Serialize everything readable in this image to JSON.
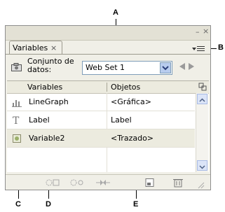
{
  "callouts": {
    "a": "A",
    "b": "B",
    "c": "C",
    "d": "D",
    "e": "E"
  },
  "panel": {
    "tab_label": "Variables",
    "tab_close": "×",
    "minimize": "–",
    "close": "×"
  },
  "dataset": {
    "label": "Conjunto de datos:",
    "selected": "Web Set 1"
  },
  "table": {
    "columns": [
      "Variables",
      "Objetos"
    ],
    "rows": [
      {
        "icon": "line-graph-icon",
        "name": "LineGraph",
        "object": "<Gráfica>"
      },
      {
        "icon": "text-variable-icon",
        "name": "Label",
        "object": "Label"
      },
      {
        "icon": "visibility-variable-icon",
        "name": "Variable2",
        "object": "<Trazado>"
      }
    ]
  },
  "colors": {
    "panel_bg": "#f0efe7",
    "selection": "#ecebdf",
    "accent": "#b8ccee"
  }
}
